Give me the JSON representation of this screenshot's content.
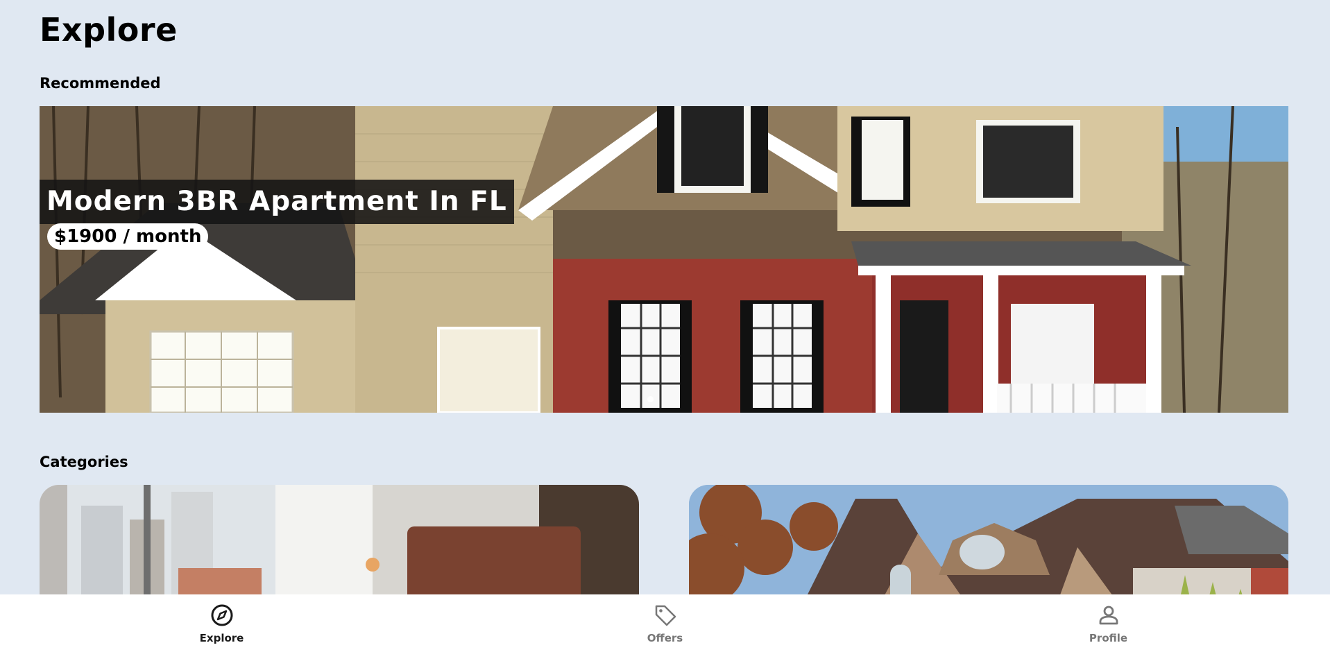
{
  "page": {
    "title": "Explore"
  },
  "sections": {
    "recommended": "Recommended",
    "categories": "Categories"
  },
  "recommended": {
    "title": "Modern 3BR Apartment In FL",
    "price": "$1900 / month"
  },
  "nav": {
    "items": [
      {
        "label": "Explore",
        "icon": "compass-icon",
        "active": true
      },
      {
        "label": "Offers",
        "icon": "tag-icon",
        "active": false
      },
      {
        "label": "Profile",
        "icon": "person-icon",
        "active": false
      }
    ]
  },
  "colors": {
    "background": "#e0e8f2",
    "nav_active": "#1a1a1a",
    "nav_inactive": "#777777"
  }
}
